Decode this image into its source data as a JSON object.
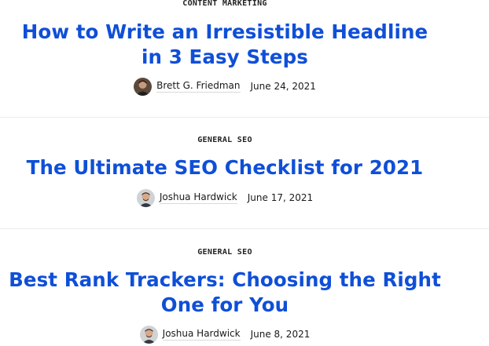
{
  "articles": [
    {
      "category": "CONTENT MARKETING",
      "title_lines": [
        "How to Write an Irresistible Headline",
        "in 3 Easy Steps"
      ],
      "author": "Brett G. Friedman",
      "date": "June 24, 2021"
    },
    {
      "category": "GENERAL SEO",
      "title_lines": [
        "The Ultimate SEO Checklist for 2021"
      ],
      "author": "Joshua Hardwick",
      "date": "June 17, 2021"
    },
    {
      "category": "GENERAL SEO",
      "title_lines": [
        "Best Rank Trackers: Choosing the Right",
        "One for You"
      ],
      "author": "Joshua Hardwick",
      "date": "June 8, 2021"
    }
  ],
  "colors": {
    "title": "#0f4fd8",
    "text": "#1a1a1a",
    "divider": "#ececec"
  }
}
